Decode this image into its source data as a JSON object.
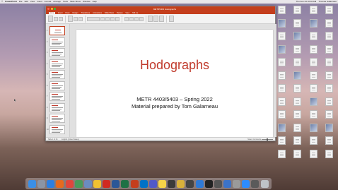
{
  "menubar": {
    "app_name": "PowerPoint",
    "menus": [
      "File",
      "Edit",
      "View",
      "Insert",
      "Format",
      "Arrange",
      "Tools",
      "Slide Show",
      "Window",
      "Help"
    ],
    "clock": "Thu Feb 24 10:02 AM",
    "user": "Thomas Galarneau"
  },
  "window": {
    "title": "METR5403 Hodographs",
    "tabs": [
      "Home",
      "Insert",
      "Draw",
      "Design",
      "Transitions",
      "Animations",
      "Slide Show",
      "Review",
      "View",
      "Tell me"
    ],
    "active_tab": "Home",
    "status": {
      "slide_counter": "Slide 1 of 16",
      "language": "English (United States)",
      "notes_label": "Notes",
      "comments_label": "Comments"
    }
  },
  "slide": {
    "title": "Hodographs",
    "subtitle_line1": "METR 4403/5403 – Spring 2022",
    "subtitle_line2": "Material prepared by Tom Galarneau"
  },
  "thumbnails": [
    {
      "num": "1"
    },
    {
      "num": "2"
    },
    {
      "num": "3"
    },
    {
      "num": "4"
    },
    {
      "num": "5"
    },
    {
      "num": "6"
    },
    {
      "num": "7"
    },
    {
      "num": "8"
    },
    {
      "num": "9"
    },
    {
      "num": "10"
    }
  ],
  "colors": {
    "brand": "#c43e1c",
    "title_red": "#c0392b"
  },
  "desktop_icons": [
    "pdf",
    "doc",
    "doc",
    "doc",
    "img",
    "doc",
    "img",
    "doc",
    "doc",
    "img",
    "doc",
    "doc",
    "img",
    "doc",
    "doc",
    "doc",
    "doc",
    "doc",
    "doc",
    "doc",
    "doc",
    "img",
    "doc",
    "doc",
    "doc",
    "doc",
    "doc",
    "doc",
    "doc",
    "doc",
    "img",
    "doc",
    "doc",
    "doc",
    "doc",
    "doc",
    "img",
    "doc",
    "img",
    "img",
    "doc",
    "doc",
    "doc",
    "doc",
    "doc",
    "doc",
    "doc",
    "doc"
  ],
  "dock": [
    {
      "name": "finder-icon",
      "color": "#3b8fe6"
    },
    {
      "name": "launchpad-icon",
      "color": "#8b94a4"
    },
    {
      "name": "safari-icon",
      "color": "#2d7fe0"
    },
    {
      "name": "firefox-icon",
      "color": "#e66a1e"
    },
    {
      "name": "chrome-icon",
      "color": "#e0463c"
    },
    {
      "name": "app-icon",
      "color": "#4a9a5b"
    },
    {
      "name": "preview-icon",
      "color": "#6b8cc0"
    },
    {
      "name": "photos-icon",
      "color": "#f1c232"
    },
    {
      "name": "acrobat-icon",
      "color": "#d02a20"
    },
    {
      "name": "word-icon",
      "color": "#2b5797"
    },
    {
      "name": "excel-icon",
      "color": "#1e7145"
    },
    {
      "name": "powerpoint-icon",
      "color": "#c43e1c"
    },
    {
      "name": "outlook-icon",
      "color": "#0072c6"
    },
    {
      "name": "teams-icon",
      "color": "#5059c9"
    },
    {
      "name": "notes-icon",
      "color": "#f7d548"
    },
    {
      "name": "app-icon",
      "color": "#3a3a3a"
    },
    {
      "name": "app-icon",
      "color": "#d9b13b"
    },
    {
      "name": "app-icon",
      "color": "#444444"
    },
    {
      "name": "app-icon",
      "color": "#2f7ad6"
    },
    {
      "name": "terminal-icon",
      "color": "#222222"
    },
    {
      "name": "app-icon",
      "color": "#555555"
    },
    {
      "name": "app-icon",
      "color": "#3c73c8"
    },
    {
      "name": "app-icon",
      "color": "#9a9a9a"
    },
    {
      "name": "app-icon",
      "color": "#2d8cff"
    },
    {
      "name": "app-icon",
      "color": "#5a5a5a"
    },
    {
      "name": "trash-icon",
      "color": "#bfc3c8"
    }
  ]
}
